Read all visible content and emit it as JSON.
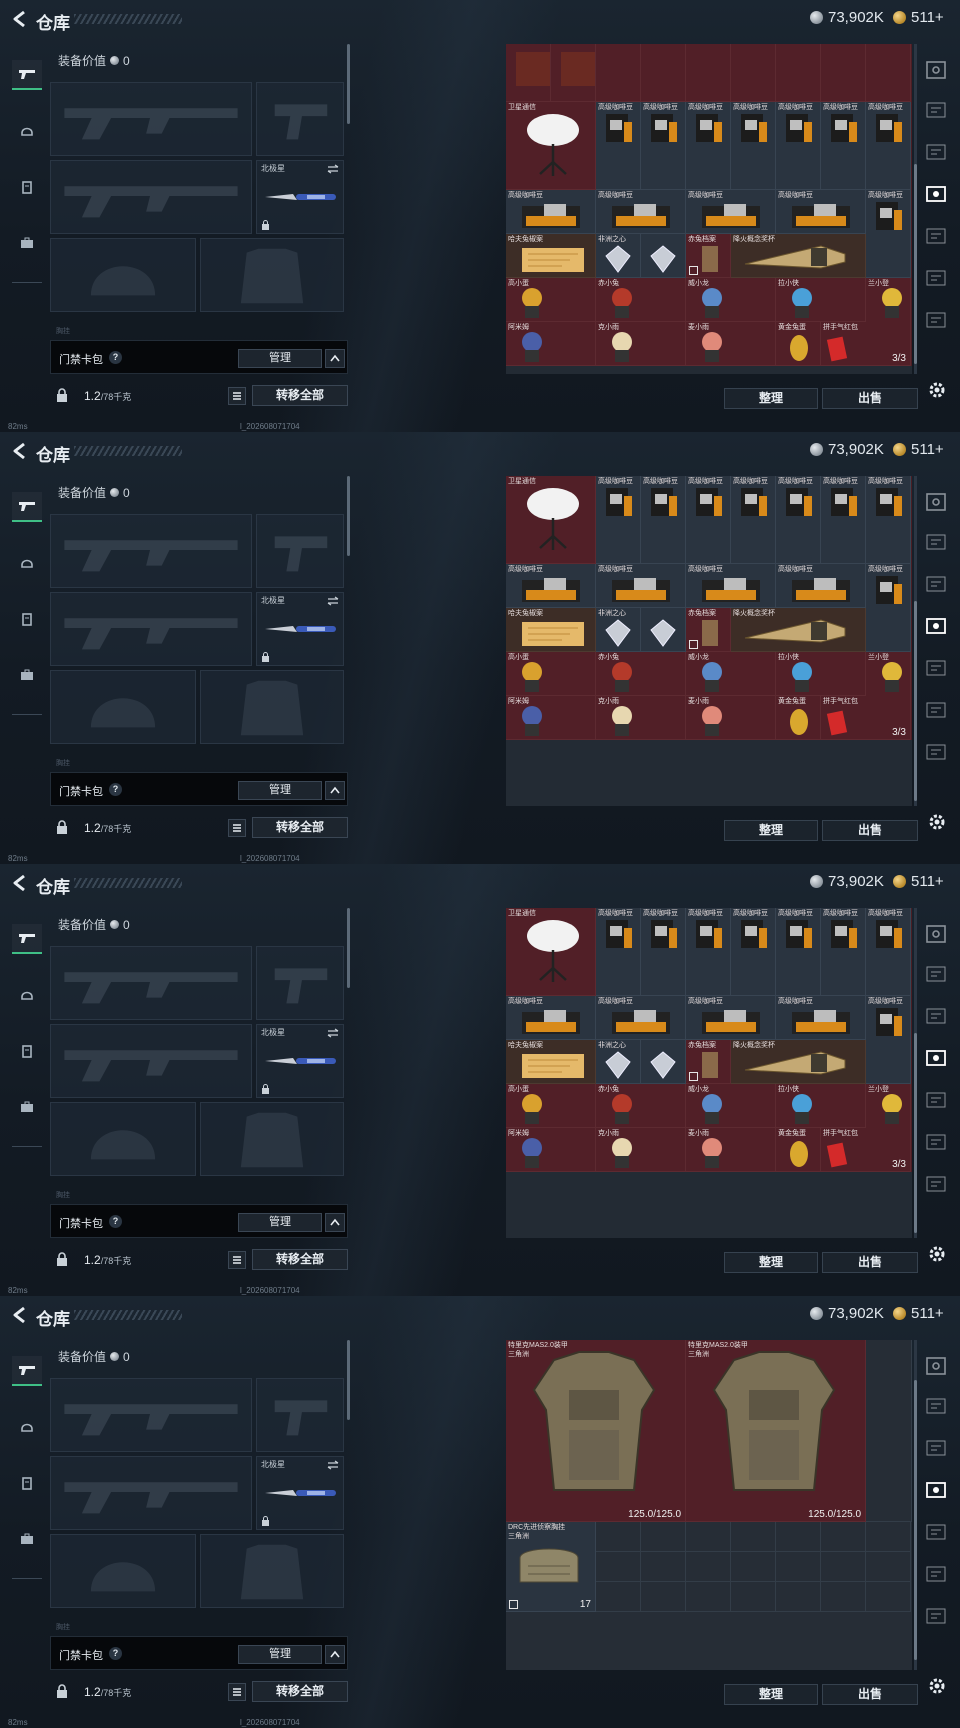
{
  "header": {
    "title": "仓库",
    "silver": "73,902K",
    "gold": "511+"
  },
  "equip": {
    "value_label": "装备价值",
    "value": "0",
    "knife_label": "北极星",
    "key_label": "门禁卡包",
    "help": "?",
    "manage_label": "管理",
    "weight_value": "1.2",
    "weight_max": "/78千克",
    "transfer_label": "转移全部",
    "faint_label": "胸挂"
  },
  "inventory": {
    "sort_label": "整理",
    "sell_label": "出售",
    "names": {
      "satellite": "卫星通信",
      "coffee": "高级咖啡豆",
      "cognac": "哈夫兔椒案",
      "ruby": "非洲之心",
      "box": "赤兔档案",
      "blade": "降火概念奖杯",
      "toy1": "高小蛋",
      "toy2": "赤小兔",
      "toy3": "威小龙",
      "toy4": "拉小侠",
      "toy5": "兰小登",
      "toy6": "阿米姆",
      "toy7": "克小雨",
      "toy8": "麦小雨",
      "egg": "黄金兔蛋",
      "redbag": "拼手气红包"
    },
    "redbag_count": "3/3",
    "armor_name": "特里克MAS2.0装甲",
    "armor_sub": "三角洲",
    "armor_durability": "125.0/125.0",
    "rig_name": "DRC先进侦察胸挂",
    "rig_sub": "三角洲",
    "rig_count": "17"
  },
  "status": {
    "ping": "82ms",
    "uid": "l_202608071704"
  },
  "colors": {
    "accent_green": "#3fbf86",
    "grid_red": "#511f27",
    "panel_dark": "#06080b"
  }
}
